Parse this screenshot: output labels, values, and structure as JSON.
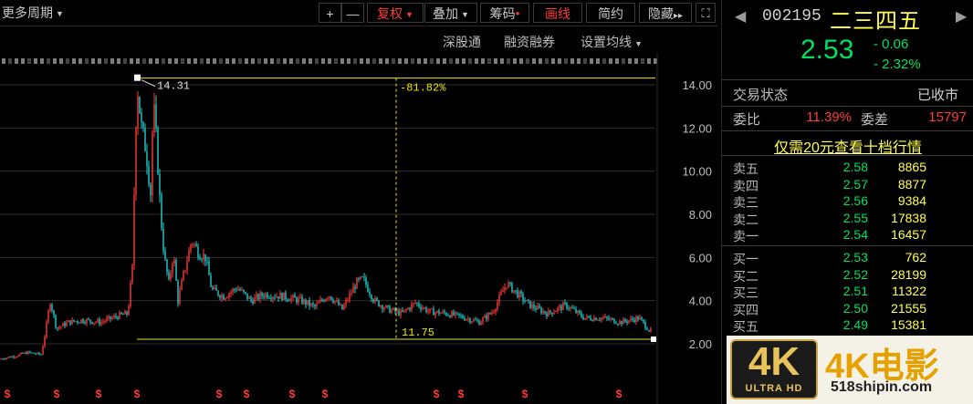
{
  "toolbar": {
    "period_label": "更多周期",
    "plus": "+",
    "minus": "—",
    "fuquan": "复权",
    "diejia": "叠加",
    "chouma": "筹码",
    "huaxian": "画线",
    "jianyue": "简约",
    "yincang": "隐藏",
    "more": "▸▸",
    "expand": "⛶"
  },
  "subbar": {
    "shengutong": "深股通",
    "rongzi": "融资融券",
    "junxian": "设置均线"
  },
  "chart_data": {
    "type": "candlestick",
    "ylim": [
      2.0,
      14.6
    ],
    "yticks": [
      "14.00",
      "12.00",
      "10.00",
      "8.00",
      "6.00",
      "4.00",
      "2.00"
    ],
    "high_label": "14.31",
    "low_label": "11.75",
    "pct_label": "-81.82%",
    "high_value": 14.31,
    "low_value": 2.55,
    "colors": {
      "up": "#ff3b3b",
      "down": "#20d0d0",
      "line": "#e8e800"
    }
  },
  "quote": {
    "code": "002195",
    "name": "二三四五",
    "price": "2.53",
    "change": "- 0.06",
    "change_pct": "- 2.32%",
    "status_label": "交易状态",
    "status_value": "已收市",
    "weibi_label": "委比",
    "weibi_value": "11.39%",
    "weicha_label": "委差",
    "weicha_value": "15797",
    "promo": "仅需20元查看十档行情",
    "sell": [
      {
        "name": "卖五",
        "price": "2.58",
        "vol": "8865"
      },
      {
        "name": "卖四",
        "price": "2.57",
        "vol": "8877"
      },
      {
        "name": "卖三",
        "price": "2.56",
        "vol": "9384"
      },
      {
        "name": "卖二",
        "price": "2.55",
        "vol": "17838"
      },
      {
        "name": "卖一",
        "price": "2.54",
        "vol": "16457"
      }
    ],
    "buy": [
      {
        "name": "买一",
        "price": "2.53",
        "vol": "762"
      },
      {
        "name": "买二",
        "price": "2.52",
        "vol": "28199"
      },
      {
        "name": "买三",
        "price": "2.51",
        "vol": "11322"
      },
      {
        "name": "买四",
        "price": "2.50",
        "vol": "21555"
      },
      {
        "name": "买五",
        "price": "2.49",
        "vol": "15381"
      }
    ]
  },
  "watermark": {
    "badge": "4K",
    "badge_sub": "ULTRA HD",
    "title": "4K电影",
    "url": "518shipin.com"
  }
}
